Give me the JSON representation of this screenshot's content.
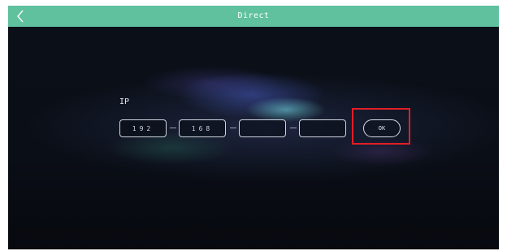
{
  "header": {
    "title": "Direct",
    "back_icon": "chevron-left-icon",
    "bar_color": "#5fc19d"
  },
  "form": {
    "ip_label": "IP",
    "octets": [
      "192",
      "168",
      "",
      ""
    ],
    "ok_label": "OK"
  },
  "highlight": {
    "target": "ok-button",
    "color": "#e21f26"
  }
}
